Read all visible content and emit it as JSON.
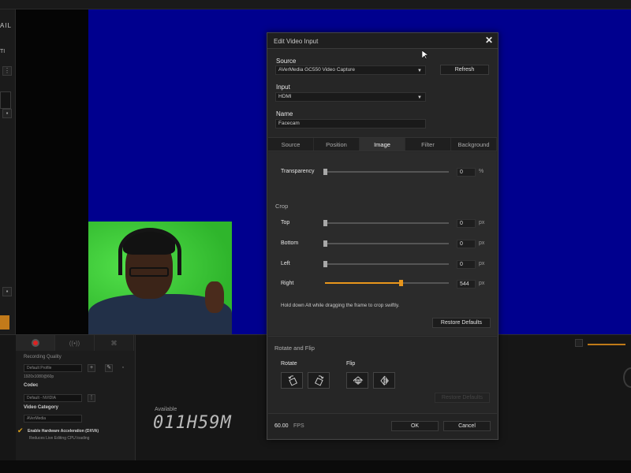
{
  "app": {
    "logo_text": "AIL",
    "left_label": "TI"
  },
  "bottom_panel": {
    "recording_quality_label": "Recording Quality",
    "profile_value": "Default Profile",
    "profile_detail": "1920x1080@60p",
    "codec_label": "Codec",
    "codec_value": "Default - NVIDIA",
    "video_category_label": "Video Category",
    "category_value": "AVerMedia",
    "hw_accel_label": "Enable Hardware Acceleration (DXVA)",
    "hw_accel_hint": "Reduces Live Editing CPU loading",
    "available_label": "Available",
    "available_time": "011H59M"
  },
  "dialog": {
    "title": "Edit Video Input",
    "source_label": "Source",
    "source_value": "AVerMedia GC550 Video Capture",
    "refresh_label": "Refresh",
    "input_label": "Input",
    "input_value": "HDMI",
    "name_label": "Name",
    "name_value": "Facecam",
    "tabs": [
      "Source",
      "Position",
      "Image",
      "Filter",
      "Background"
    ],
    "active_tab": "Image",
    "transparency": {
      "label": "Transparency",
      "value": "0",
      "unit": "%",
      "level": 0
    },
    "crop": {
      "heading": "Crop",
      "rows": [
        {
          "label": "Top",
          "value": "0",
          "unit": "px",
          "level": 0
        },
        {
          "label": "Bottom",
          "value": "0",
          "unit": "px",
          "level": 0
        },
        {
          "label": "Left",
          "value": "0",
          "unit": "px",
          "level": 0
        },
        {
          "label": "Right",
          "value": "544",
          "unit": "px",
          "level": 0.61
        }
      ],
      "hint": "Hold down Alt while dragging the frame to crop swiftly.",
      "restore_label": "Restore Defaults"
    },
    "rotate_flip": {
      "heading": "Rotate and Flip",
      "rotate_label": "Rotate",
      "flip_label": "Flip",
      "restore_label": "Restore Defaults"
    },
    "fps_value": "60.00",
    "fps_unit": "FPS",
    "ok_label": "OK",
    "cancel_label": "Cancel"
  },
  "colors": {
    "accent": "#e8961c",
    "preview_bg": "#00008e",
    "chroma_green": "#2fc22c"
  }
}
